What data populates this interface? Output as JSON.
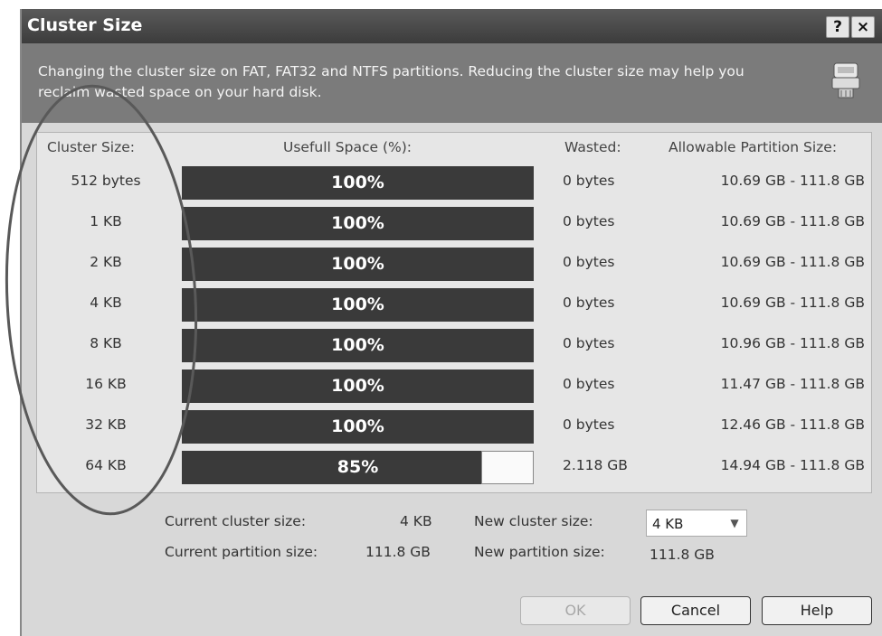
{
  "window": {
    "title": "Cluster Size",
    "help_button": "?",
    "close_button": "×"
  },
  "header": {
    "description": "Changing the cluster size on FAT, FAT32 and NTFS partitions. Reducing the cluster size may help you reclaim wasted space on your hard disk.",
    "icon": "disk-tool-icon"
  },
  "table": {
    "columns": {
      "cluster_size": "Cluster Size:",
      "useful_space": "Usefull Space (%):",
      "wasted": "Wasted:",
      "allowable": "Allowable Partition Size:"
    },
    "rows": [
      {
        "cluster": "512 bytes",
        "useful_label": "100%",
        "useful_fraction": 1.0,
        "wasted": "0 bytes",
        "allowable": "10.69 GB - 111.8 GB"
      },
      {
        "cluster": "1 KB",
        "useful_label": "100%",
        "useful_fraction": 1.0,
        "wasted": "0 bytes",
        "allowable": "10.69 GB - 111.8 GB"
      },
      {
        "cluster": "2 KB",
        "useful_label": "100%",
        "useful_fraction": 1.0,
        "wasted": "0 bytes",
        "allowable": "10.69 GB - 111.8 GB"
      },
      {
        "cluster": "4 KB",
        "useful_label": "100%",
        "useful_fraction": 1.0,
        "wasted": "0 bytes",
        "allowable": "10.69 GB - 111.8 GB"
      },
      {
        "cluster": "8 KB",
        "useful_label": "100%",
        "useful_fraction": 1.0,
        "wasted": "0 bytes",
        "allowable": "10.96 GB - 111.8 GB"
      },
      {
        "cluster": "16 KB",
        "useful_label": "100%",
        "useful_fraction": 1.0,
        "wasted": "0 bytes",
        "allowable": "11.47 GB - 111.8 GB"
      },
      {
        "cluster": "32 KB",
        "useful_label": "100%",
        "useful_fraction": 1.0,
        "wasted": "0 bytes",
        "allowable": "12.46 GB - 111.8 GB"
      },
      {
        "cluster": "64 KB",
        "useful_label": "85%",
        "useful_fraction": 0.85,
        "wasted": "2.118 GB",
        "allowable": "14.94 GB - 111.8 GB"
      }
    ]
  },
  "info": {
    "current_cluster_label": "Current cluster size:",
    "current_cluster_value": "4 KB",
    "current_partition_label": "Current partition size:",
    "current_partition_value": "111.8 GB",
    "new_cluster_label": "New cluster size:",
    "new_cluster_value": "4 KB",
    "new_partition_label": "New partition size:",
    "new_partition_value": "111.8 GB"
  },
  "buttons": {
    "ok": "OK",
    "cancel": "Cancel",
    "help": "Help"
  },
  "colors": {
    "bar": "#3a3a3a",
    "header_bg": "#7b7b7b",
    "dialog_bg": "#d8d8d8"
  }
}
